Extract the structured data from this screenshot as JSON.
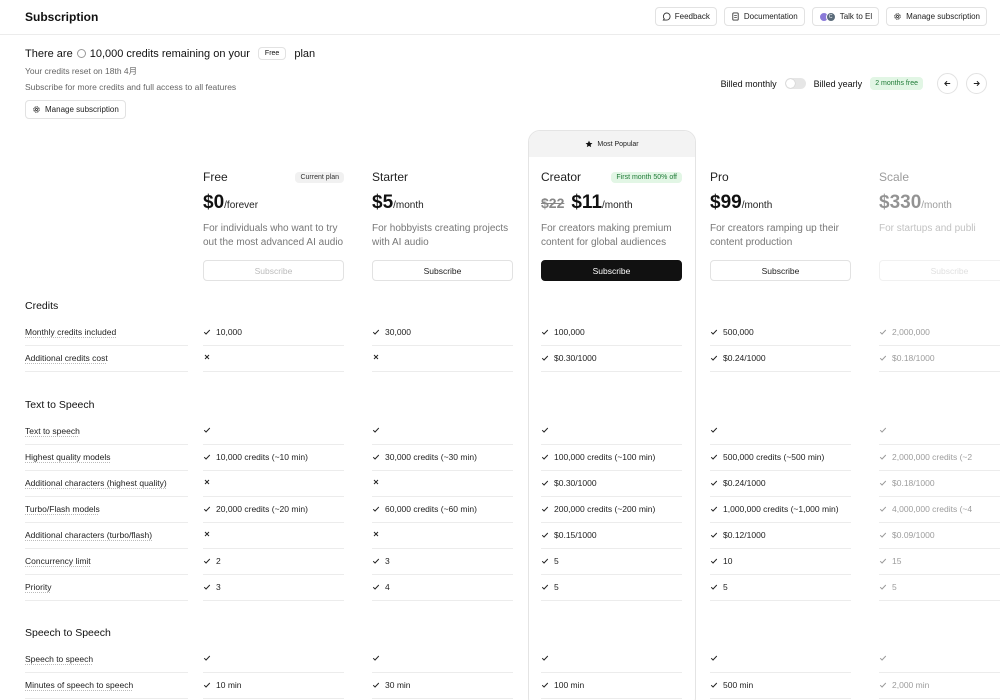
{
  "header": {
    "title": "Subscription",
    "feedback": "Feedback",
    "documentation": "Documentation",
    "talk": "Talk to El",
    "avatar_letter": "C",
    "manage": "Manage subscription"
  },
  "summary": {
    "prefix": "There are",
    "credits": "10,000 credits remaining on your",
    "plan_pill": "Free",
    "suffix": "plan",
    "reset": "Your credits reset on 18th 4月",
    "upsell": "Subscribe for more credits and full access to all features",
    "manage": "Manage subscription"
  },
  "billing": {
    "monthly": "Billed monthly",
    "yearly": "Billed yearly",
    "promo": "2 months free"
  },
  "most_popular": "Most Popular",
  "plans": [
    {
      "name": "Free",
      "badge": "Current plan",
      "old": "",
      "price": "$0",
      "unit": "/forever",
      "desc": "For individuals who want to try out the most advanced AI audio",
      "button": "Subscribe"
    },
    {
      "name": "Starter",
      "badge": "",
      "old": "",
      "price": "$5",
      "unit": "/month",
      "desc": "For hobbyists creating projects with AI audio",
      "button": "Subscribe"
    },
    {
      "name": "Creator",
      "badge": "First month 50% off",
      "old": "$22",
      "price": "$11",
      "unit": "/month",
      "desc": "For creators making premium content for global audiences",
      "button": "Subscribe"
    },
    {
      "name": "Pro",
      "badge": "",
      "old": "",
      "price": "$99",
      "unit": "/month",
      "desc": "For creators ramping up their content production",
      "button": "Subscribe"
    },
    {
      "name": "Scale",
      "badge": "",
      "old": "",
      "price": "$330",
      "unit": "/month",
      "desc": "For startups and publi",
      "button": "Subscribe"
    }
  ],
  "sections": {
    "credits": "Credits",
    "tts": "Text to Speech",
    "sts": "Speech to Speech"
  },
  "rows": {
    "r0": {
      "label": "Monthly credits included",
      "v": [
        "10,000",
        "30,000",
        "100,000",
        "500,000",
        "2,000,000"
      ],
      "x": [
        false,
        false,
        false,
        false,
        false
      ]
    },
    "r1": {
      "label": "Additional credits cost",
      "v": [
        "",
        "",
        "$0.30/1000",
        "$0.24/1000",
        "$0.18/1000"
      ],
      "x": [
        true,
        true,
        false,
        false,
        false
      ]
    },
    "r2": {
      "label": "Text to speech",
      "v": [
        "",
        "",
        "",
        "",
        ""
      ],
      "x": [
        false,
        false,
        false,
        false,
        false
      ]
    },
    "r3": {
      "label": "Highest quality models",
      "v": [
        "10,000 credits (~10 min)",
        "30,000 credits (~30 min)",
        "100,000 credits (~100 min)",
        "500,000 credits (~500 min)",
        "2,000,000 credits (~2"
      ],
      "x": [
        false,
        false,
        false,
        false,
        false
      ]
    },
    "r4": {
      "label": "Additional characters (highest quality)",
      "v": [
        "",
        "",
        "$0.30/1000",
        "$0.24/1000",
        "$0.18/1000"
      ],
      "x": [
        true,
        true,
        false,
        false,
        false
      ]
    },
    "r5": {
      "label": "Turbo/Flash models",
      "v": [
        "20,000 credits (~20 min)",
        "60,000 credits (~60 min)",
        "200,000 credits (~200 min)",
        "1,000,000 credits (~1,000 min)",
        "4,000,000 credits (~4"
      ],
      "x": [
        false,
        false,
        false,
        false,
        false
      ]
    },
    "r6": {
      "label": "Additional characters (turbo/flash)",
      "v": [
        "",
        "",
        "$0.15/1000",
        "$0.12/1000",
        "$0.09/1000"
      ],
      "x": [
        true,
        true,
        false,
        false,
        false
      ]
    },
    "r7": {
      "label": "Concurrency limit",
      "v": [
        "2",
        "3",
        "5",
        "10",
        "15"
      ],
      "x": [
        false,
        false,
        false,
        false,
        false
      ]
    },
    "r8": {
      "label": "Priority",
      "v": [
        "3",
        "4",
        "5",
        "5",
        "5"
      ],
      "x": [
        false,
        false,
        false,
        false,
        false
      ]
    },
    "r9": {
      "label": "Speech to speech",
      "v": [
        "",
        "",
        "",
        "",
        ""
      ],
      "x": [
        false,
        false,
        false,
        false,
        false
      ]
    },
    "r10": {
      "label": "Minutes of speech to speech",
      "v": [
        "10 min",
        "30 min",
        "100 min",
        "500 min",
        "2,000 min"
      ],
      "x": [
        false,
        false,
        false,
        false,
        false
      ]
    }
  },
  "colors": {
    "accent": "#111111",
    "promo_bg": "#e2f6e5",
    "promo_text": "#1e7a36"
  }
}
